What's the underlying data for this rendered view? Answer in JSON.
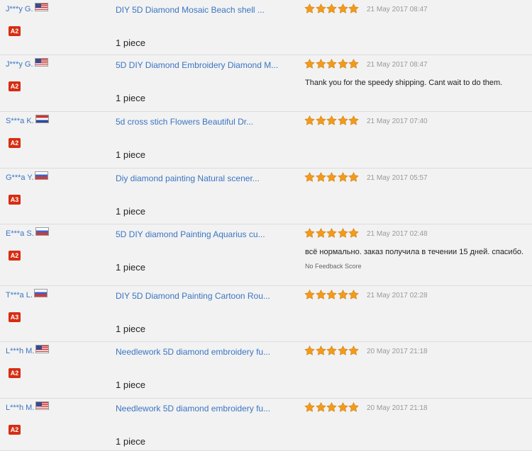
{
  "colors": {
    "link": "#3b75c2",
    "badge": "#d72d12",
    "star": "#f29a1a",
    "date": "#999999"
  },
  "reviews": [
    {
      "buyer": "J***y G.",
      "flag": "us",
      "badge": "A2",
      "product": "DIY 5D Diamond Mosaic Beach shell ...",
      "quantity": "1 piece",
      "stars": 5,
      "date": "21 May 2017 08:47",
      "comment": "",
      "note": ""
    },
    {
      "buyer": "J***y G.",
      "flag": "us",
      "badge": "A2",
      "product": "5D DIY Diamond Embroidery Diamond M...",
      "quantity": "1 piece",
      "stars": 5,
      "date": "21 May 2017 08:47",
      "comment": "Thank you for the speedy shipping. Cant wait to do them.",
      "note": ""
    },
    {
      "buyer": "S***a K.",
      "flag": "nl",
      "badge": "A2",
      "product": "5d cross stich Flowers Beautiful Dr...",
      "quantity": "1 piece",
      "stars": 5,
      "date": "21 May 2017 07:40",
      "comment": "",
      "note": ""
    },
    {
      "buyer": "G***a Y.",
      "flag": "ru",
      "badge": "A3",
      "product": "Diy diamond painting Natural scener...",
      "quantity": "1 piece",
      "stars": 5,
      "date": "21 May 2017 05:57",
      "comment": "",
      "note": ""
    },
    {
      "buyer": "E***a S.",
      "flag": "ru",
      "badge": "A2",
      "product": "5D DIY diamond Painting Aquarius cu...",
      "quantity": "1 piece",
      "stars": 5,
      "date": "21 May 2017 02:48",
      "comment": "всё нормально. заказ получила в течении 15 дней. спасибо.",
      "note": "No Feedback Score"
    },
    {
      "buyer": "T***a L.",
      "flag": "ru",
      "badge": "A3",
      "product": "DIY 5D Diamond Painting Cartoon Rou...",
      "quantity": "1 piece",
      "stars": 5,
      "date": "21 May 2017 02:28",
      "comment": "",
      "note": ""
    },
    {
      "buyer": "L***h M.",
      "flag": "us",
      "badge": "A2",
      "product": "Needlework 5D diamond embroidery fu...",
      "quantity": "1 piece",
      "stars": 5,
      "date": "20 May 2017 21:18",
      "comment": "",
      "note": ""
    },
    {
      "buyer": "L***h M.",
      "flag": "us",
      "badge": "A2",
      "product": "Needlework 5D diamond embroidery fu...",
      "quantity": "1 piece",
      "stars": 5,
      "date": "20 May 2017 21:18",
      "comment": "",
      "note": ""
    }
  ]
}
